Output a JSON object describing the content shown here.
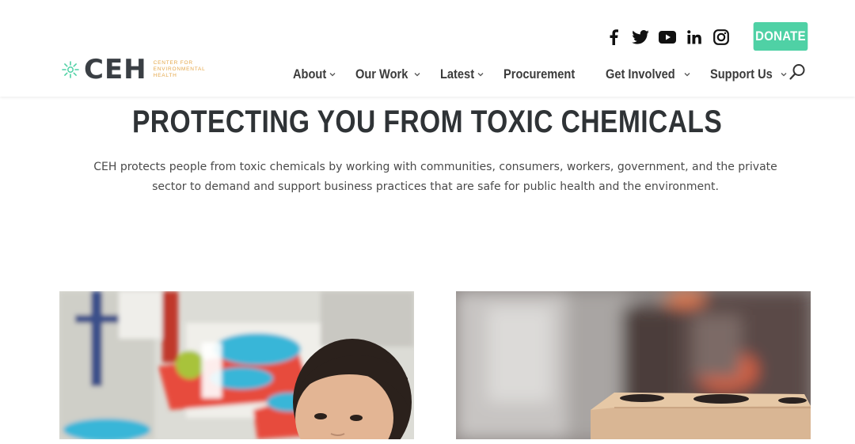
{
  "brand": {
    "logo_text": "CEH",
    "logo_sub_lines": [
      "Center for",
      "Environmental",
      "Health"
    ],
    "accent_green": "#4fd1a5",
    "accent_gold": "#e4a74a"
  },
  "social": [
    {
      "name": "facebook-icon"
    },
    {
      "name": "twitter-icon"
    },
    {
      "name": "youtube-icon"
    },
    {
      "name": "linkedin-icon"
    },
    {
      "name": "instagram-icon"
    }
  ],
  "donate_label": "DONATE",
  "nav": {
    "items": [
      {
        "label": "About",
        "has_dropdown": true
      },
      {
        "label": "Our Work",
        "has_dropdown": true
      },
      {
        "label": "Latest",
        "has_dropdown": true
      },
      {
        "label": "Procurement",
        "has_dropdown": false
      },
      {
        "label": "Get Involved",
        "has_dropdown": true
      },
      {
        "label": "Support Us",
        "has_dropdown": true
      }
    ]
  },
  "hero": {
    "headline": "PROTECTING YOU FROM TOXIC CHEMICALS",
    "intro": "CEH protects people from toxic chemicals by working with communities, consumers, workers, government, and the private sector to demand and support business practices that are safe for public health and the environment."
  }
}
